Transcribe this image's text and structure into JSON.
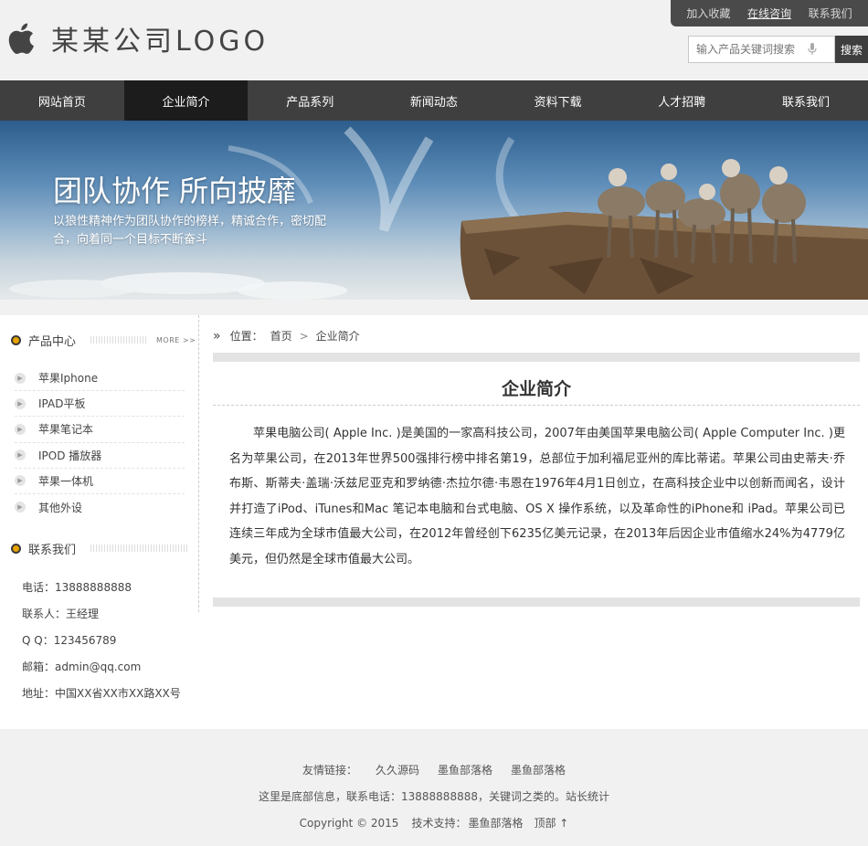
{
  "header": {
    "logo_text": "某某公司LOGO",
    "toplinks": [
      "加入收藏",
      "在线咨询",
      "联系我们"
    ],
    "search_placeholder": "输入产品关键词搜索",
    "search_button": "搜索"
  },
  "nav": {
    "items": [
      "网站首页",
      "企业简介",
      "产品系列",
      "新闻动态",
      "资料下载",
      "人才招聘",
      "联系我们"
    ],
    "active_index": 1
  },
  "banner": {
    "title": "团队协作 所向披靡",
    "subtitle": "以狼性精神作为团队协作的榜样，精诚合作，密切配合，向着同一个目标不断奋斗"
  },
  "sidebar": {
    "products_title": "产品中心",
    "more_label": "MORE >>",
    "products": [
      "苹果Iphone",
      "IPAD平板",
      "苹果笔记本",
      "IPOD 播放器",
      "苹果一体机",
      "其他外设"
    ],
    "contact_title": "联系我们",
    "contact": [
      "电话：13888888888",
      "联系人：王经理",
      "Q Q：123456789",
      "邮箱：admin@qq.com",
      "地址：中国XX省XX市XX路XX号"
    ]
  },
  "main": {
    "breadcrumb_prefix": "位置：",
    "breadcrumb_home": "首页",
    "breadcrumb_sep": ">",
    "breadcrumb_current": "企业简介",
    "title": "企业简介",
    "article": "苹果电脑公司( Apple Inc. )是美国的一家高科技公司，2007年由美国苹果电脑公司( Apple Computer Inc. )更名为苹果公司，在2013年世界500强排行榜中排名第19，总部位于加利福尼亚州的库比蒂诺。苹果公司由史蒂夫·乔布斯、斯蒂夫·盖瑞·沃兹尼亚克和罗纳德·杰拉尔德·韦恩在1976年4月1日创立，在高科技企业中以创新而闻名，设计并打造了iPod、iTunes和Mac 笔记本电脑和台式电脑、OS X 操作系统，以及革命性的iPhone和 iPad。苹果公司已连续三年成为全球市值最大公司，在2012年曾经创下6235亿美元记录，在2013年后因企业市值缩水24%为4779亿美元，但仍然是全球市值最大公司。"
  },
  "footer": {
    "links_label": "友情链接：",
    "links": [
      "久久源码",
      "墨鱼部落格",
      "墨鱼部落格"
    ],
    "info": "这里是底部信息，联系电话：13888888888，关键词之类的。站长统计",
    "copyright": "Copyright © 2015",
    "tech_label": "技术支持：",
    "tech_value": "墨鱼部落格",
    "top_link": "顶部 ↑"
  },
  "colors": {
    "nav_bg": "#3f3f3f",
    "nav_active_bg": "#1c1c1c",
    "accent_dot": "#e6a200"
  }
}
